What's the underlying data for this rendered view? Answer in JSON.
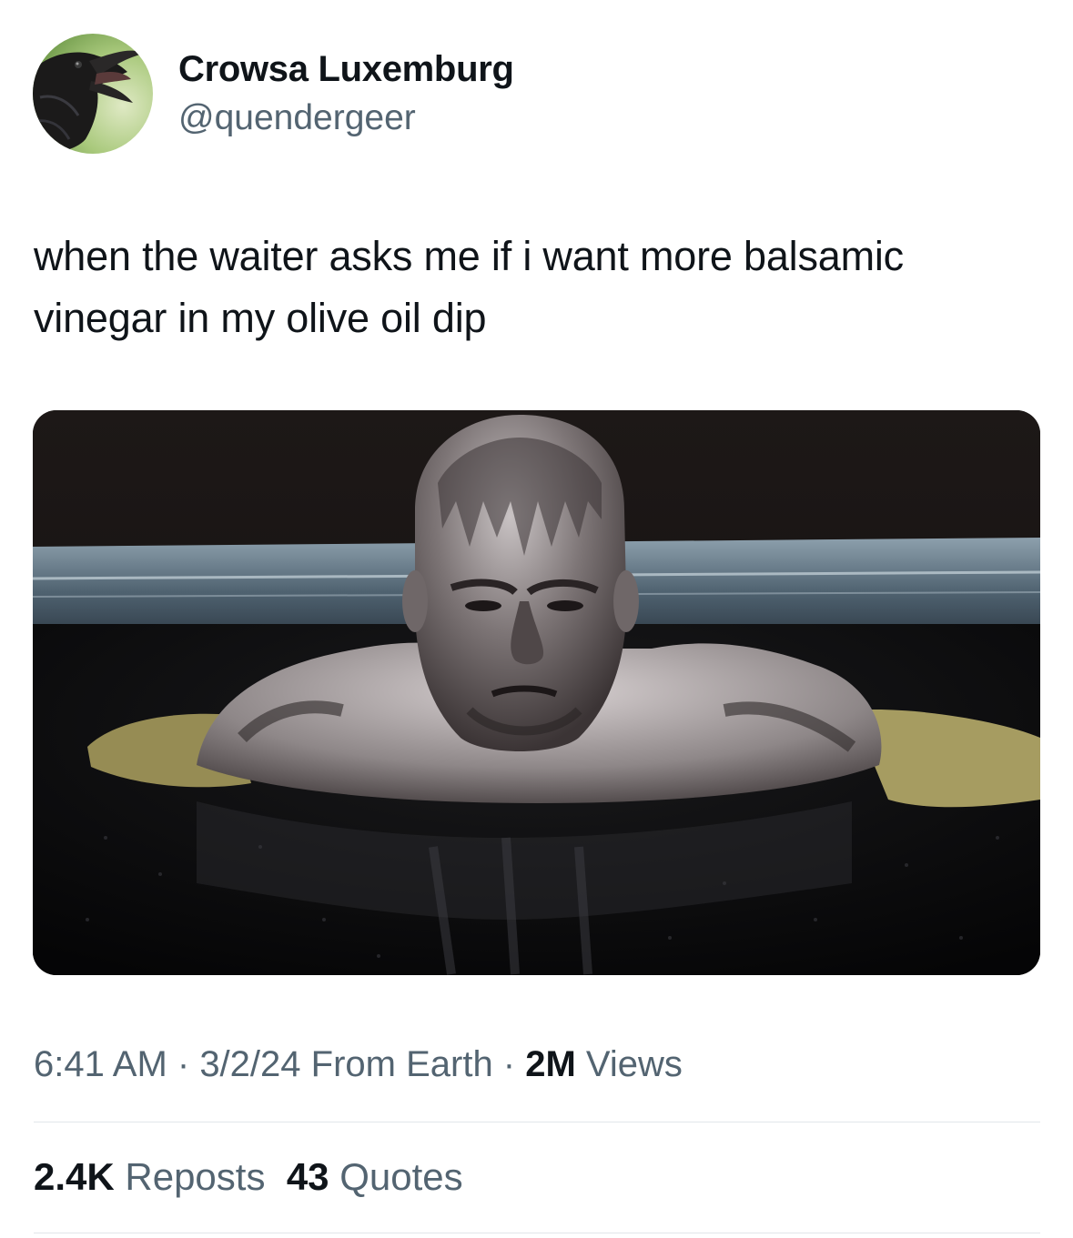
{
  "author": {
    "display_name": "Crowsa Luxemburg",
    "handle": "@quendergeer",
    "avatar_icon": "crow-avatar"
  },
  "tweet": {
    "text_line1": "when the waiter asks me if i want more balsamic",
    "text_line2": "vinegar in my olive oil dip"
  },
  "media": {
    "icon": "photo-bald-man-in-dark-liquid"
  },
  "meta": {
    "time": "6:41 AM",
    "separator1": " · ",
    "date": "3/2/24",
    "source": " From Earth",
    "separator2": " · ",
    "views_count": "2M",
    "views_label": " Views"
  },
  "stats": {
    "reposts_count": "2.4K",
    "reposts_label": " Reposts",
    "quotes_count": "43",
    "quotes_label": " Quotes"
  },
  "colors": {
    "text_primary": "#0f1419",
    "text_secondary": "#536471",
    "divider": "#e1e6ea"
  }
}
